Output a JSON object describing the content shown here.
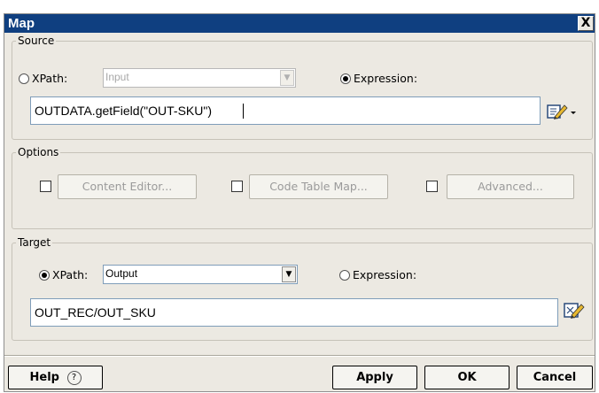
{
  "window": {
    "title": "Map",
    "close_glyph": "X"
  },
  "source": {
    "legend": "Source",
    "xpath_label": "XPath:",
    "xpath_selected": false,
    "xpath_value": "Input",
    "expression_label": "Expression:",
    "expression_selected": true,
    "expression_value": "OUTDATA.getField(\"OUT-SKU\")"
  },
  "options": {
    "legend": "Options",
    "content_editor_label": "Content Editor...",
    "code_table_map_label": "Code Table Map...",
    "advanced_label": "Advanced..."
  },
  "target": {
    "legend": "Target",
    "xpath_label": "XPath:",
    "xpath_selected": true,
    "xpath_value": "Output",
    "expression_label": "Expression:",
    "expression_selected": false,
    "xpath_path_value": "OUT_REC/OUT_SKU"
  },
  "buttons": {
    "help_label": "Help",
    "help_icon": "question-icon",
    "apply_label": "Apply",
    "ok_label": "OK",
    "cancel_label": "Cancel"
  },
  "icons": {
    "expression_editor": "edit-expression-icon",
    "xpath_editor": "edit-xpath-icon"
  },
  "colors": {
    "titlebar": "#0f3f80",
    "dialog_bg": "#ece9e2",
    "field_border": "#7f9db9"
  }
}
